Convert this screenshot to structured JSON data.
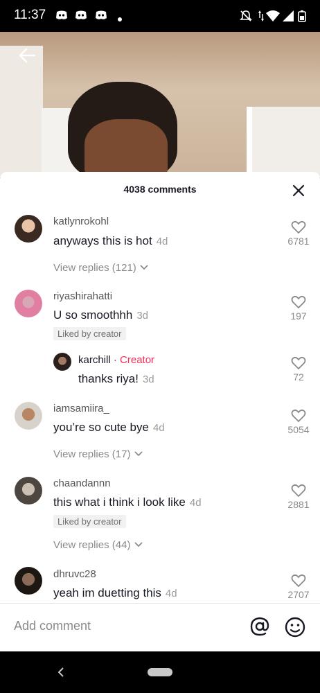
{
  "status_bar": {
    "time": "11:37"
  },
  "video": {
    "back_icon": "arrow-left-icon"
  },
  "sheet": {
    "title": "4038 comments",
    "close_icon": "close-icon"
  },
  "comments": [
    {
      "username": "katlynrokohl",
      "text": "anyways this is hot",
      "age": "4d",
      "likes": "6781",
      "view_replies": "View replies (121)"
    },
    {
      "username": "riyashirahatti",
      "text": "U so smoothhh",
      "age": "3d",
      "likes": "197",
      "badge": "Liked by creator"
    },
    {
      "username": "karchill",
      "creator_separator": "·",
      "creator_label": "Creator",
      "text": "thanks riya!",
      "age": "3d",
      "likes": "72"
    },
    {
      "username": "iamsamiira_",
      "text": "you’re so cute bye",
      "age": "4d",
      "likes": "5054",
      "view_replies": "View replies (17)"
    },
    {
      "username": "chaandannn",
      "text": "this what i think i look like",
      "age": "4d",
      "likes": "2881",
      "badge": "Liked by creator",
      "view_replies": "View replies (44)"
    },
    {
      "username": "dhruvc28",
      "text": "yeah im duetting this",
      "age": "4d",
      "likes": "2707"
    }
  ],
  "input": {
    "placeholder": "Add comment",
    "mention_icon": "at-sign-icon",
    "emoji_icon": "emoji-icon"
  },
  "nav": {
    "back_icon": "nav-back-icon",
    "home_icon": "home-pill-icon"
  }
}
